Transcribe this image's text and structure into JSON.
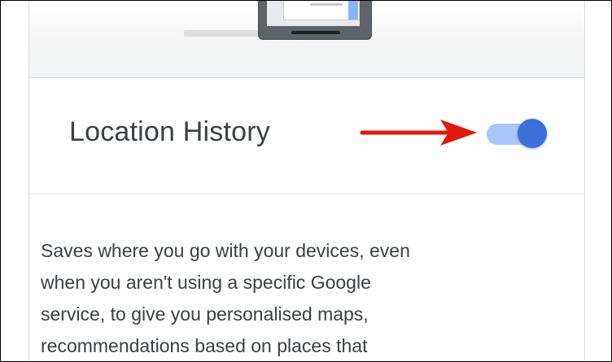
{
  "setting": {
    "title": "Location History",
    "toggle_state": "on"
  },
  "description": {
    "lines": [
      "Saves where you go with your devices, even",
      "when you aren't using a specific Google",
      "service, to give you personalised maps,",
      "recommendations based on places that"
    ]
  },
  "colors": {
    "toggle_track": "#a8c7fa",
    "toggle_thumb": "#3b6fd8",
    "arrow": "#e3170a",
    "text": "#3c4043",
    "divider": "#dadce0"
  },
  "icons": {
    "hero_illustration": "device-illustration",
    "annotation": "red-arrow-icon"
  }
}
